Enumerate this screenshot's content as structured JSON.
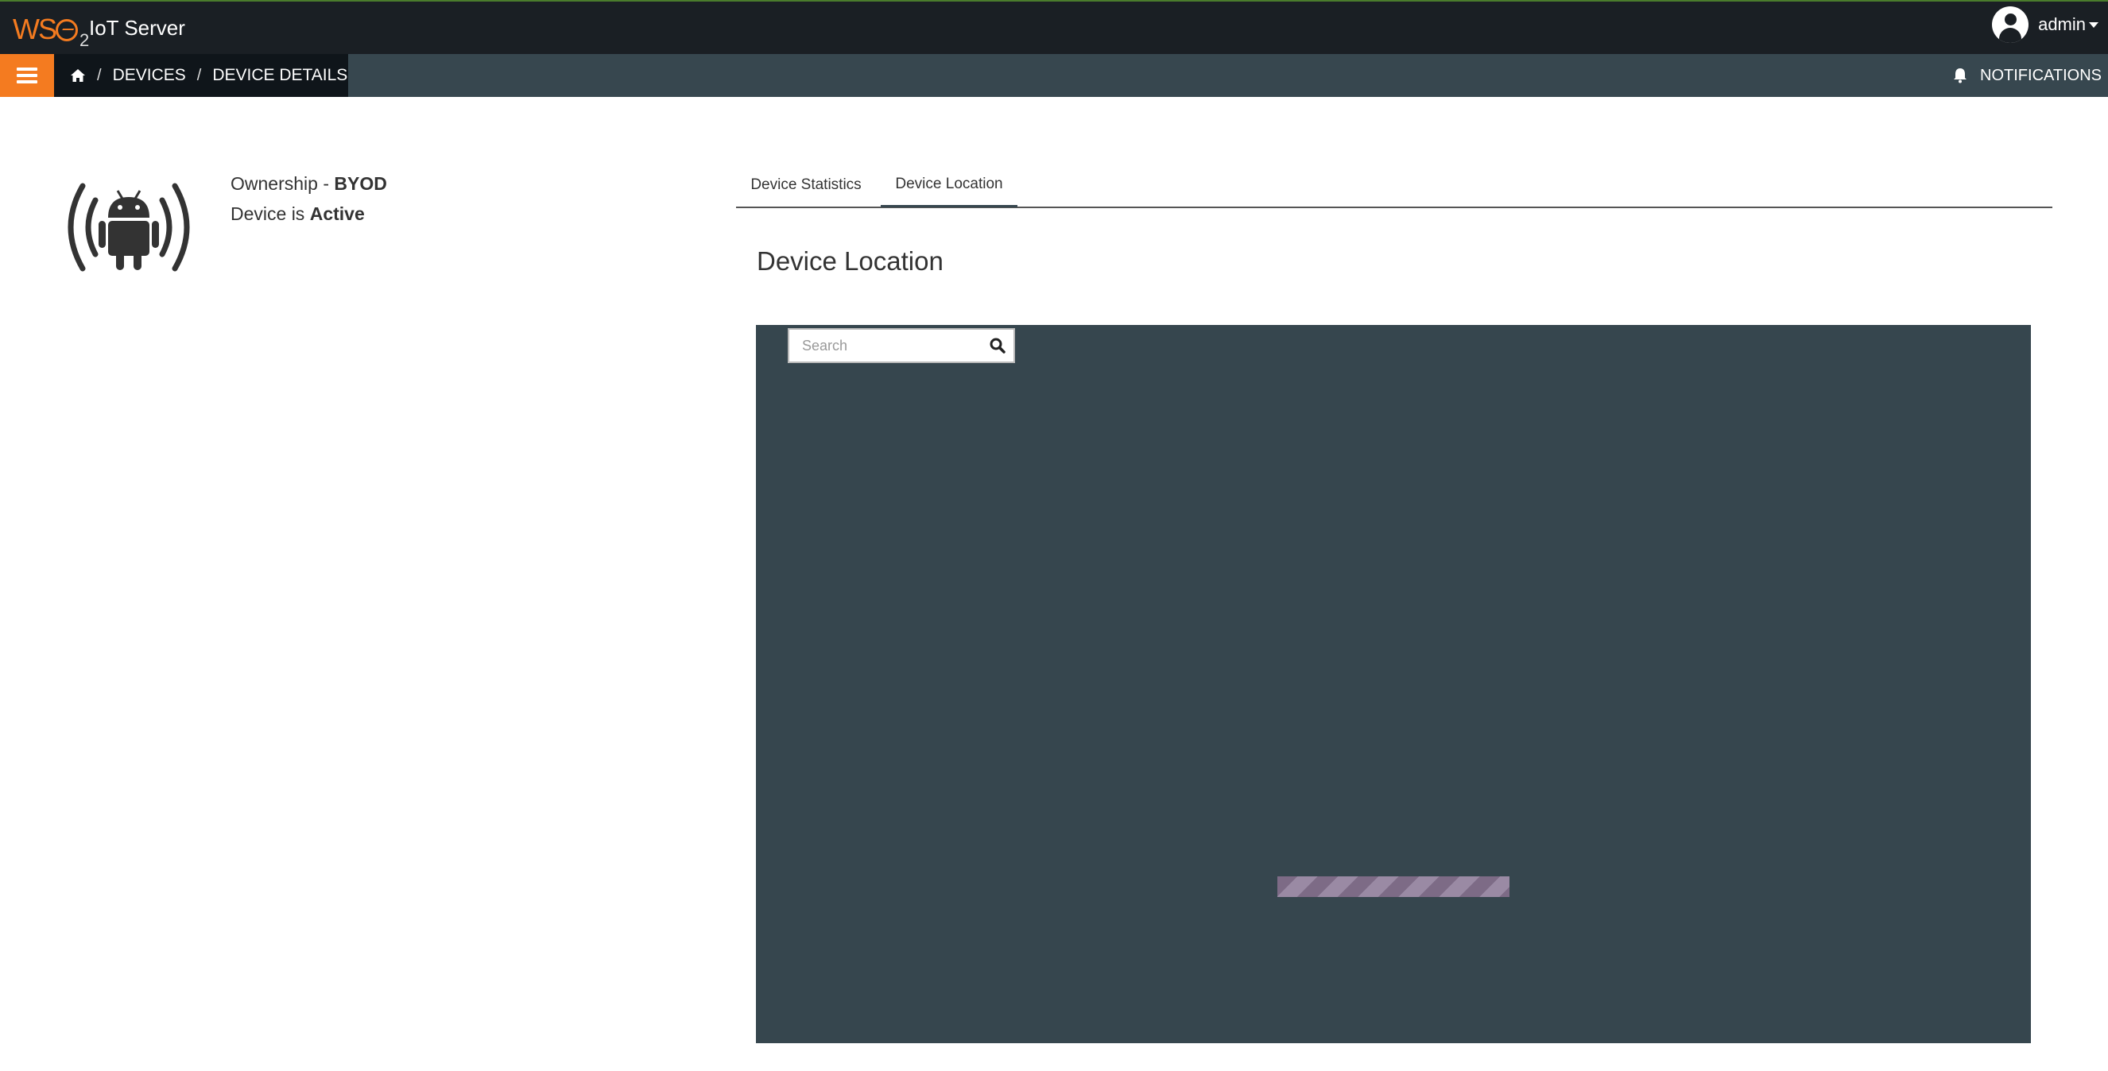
{
  "header": {
    "logo_text": "WSO2",
    "app_title": "IoT Server",
    "user_name": "admin"
  },
  "nav": {
    "breadcrumb": [
      "DEVICES",
      "DEVICE DETAILS"
    ],
    "notifications_label": "NOTIFICATIONS"
  },
  "device": {
    "ownership_label": "Ownership - ",
    "ownership_value": "BYOD",
    "status_label": "Device is ",
    "status_value": "Active"
  },
  "tabs": [
    {
      "label": "Device Statistics",
      "active": false
    },
    {
      "label": "Device Location",
      "active": true
    }
  ],
  "section_title": "Device Location",
  "map": {
    "search_placeholder": "Search"
  },
  "colors": {
    "accent": "#f47b20",
    "topbar": "#1a1f24",
    "navbar": "#37474f",
    "map_bg": "#36464e"
  },
  "icons": [
    "user-avatar-icon",
    "hamburger-menu-icon",
    "home-icon",
    "bell-icon",
    "android-device-icon",
    "search-icon"
  ]
}
